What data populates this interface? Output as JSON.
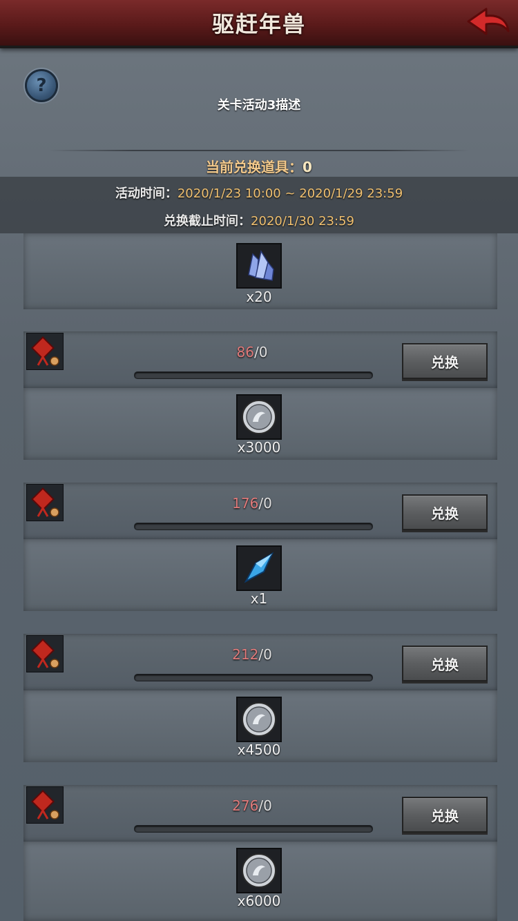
{
  "header": {
    "title": "驱赶年兽"
  },
  "intro": {
    "description": "关卡活动3描述",
    "current_label": "当前兑换道具：",
    "current_value": "0",
    "activity_time_label": "活动时间：",
    "activity_time_value": "2020/1/23 10:00 ~ 2020/1/29 23:59",
    "deadline_label": "兑换截止时间：",
    "deadline_value": "2020/1/30 23:59"
  },
  "top_item": {
    "icon": "crystal-cluster-icon",
    "qty": "x20"
  },
  "rewards": [
    {
      "cost": "86",
      "owned": "/0",
      "button": "兑换",
      "item_icon": "silver-coin-icon",
      "qty": "x3000"
    },
    {
      "cost": "176",
      "owned": "/0",
      "button": "兑换",
      "item_icon": "blue-crystal-icon",
      "qty": "x1"
    },
    {
      "cost": "212",
      "owned": "/0",
      "button": "兑换",
      "item_icon": "silver-coin-icon",
      "qty": "x4500"
    },
    {
      "cost": "276",
      "owned": "/0",
      "button": "兑换",
      "item_icon": "silver-coin-icon",
      "qty": "x6000"
    }
  ],
  "colors": {
    "accent_red": "#e07a7a",
    "gold": "#f0c070",
    "header_red": "#5a1a1a"
  }
}
